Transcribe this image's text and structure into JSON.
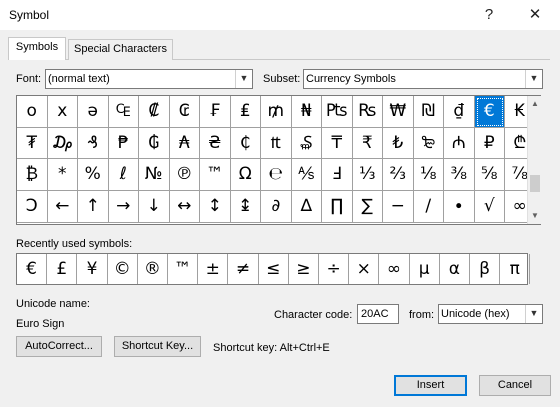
{
  "window": {
    "title": "Symbol",
    "help_label": "?",
    "close_label": "✕"
  },
  "tabs": [
    {
      "label": "Symbols",
      "active": true
    },
    {
      "label": "Special Characters",
      "active": false
    }
  ],
  "font": {
    "label": "Font:",
    "value": "(normal text)"
  },
  "subset": {
    "label": "Subset:",
    "value": "Currency Symbols"
  },
  "symbol_grid": {
    "rows": [
      [
        "ο",
        "х",
        "ə",
        "₠",
        "₡",
        "₢",
        "₣",
        "₤",
        "₥",
        "₦",
        "₧",
        "₨",
        "₩",
        "₪",
        "₫",
        "€",
        "₭"
      ],
      [
        "₮",
        "₯",
        "₰",
        "₱",
        "₲",
        "₳",
        "₴",
        "₵",
        "₶",
        "₷",
        "₸",
        "₹",
        "₺",
        "₻",
        "₼",
        "₽",
        "₾"
      ],
      [
        "₿",
        "*",
        "%",
        "ℓ",
        "№",
        "℗",
        "™",
        "Ω",
        "℮",
        "⅍",
        "Ⅎ",
        "⅓",
        "⅔",
        "⅛",
        "⅜",
        "⅝",
        "⅞"
      ],
      [
        "Ↄ",
        "←",
        "↑",
        "→",
        "↓",
        "↔",
        "↕",
        "↨",
        "∂",
        "∆",
        "∏",
        "∑",
        "−",
        "∕",
        "∙",
        "√",
        "∞"
      ]
    ],
    "selected": "€"
  },
  "recent": {
    "label": "Recently used symbols:",
    "symbols": [
      "€",
      "£",
      "¥",
      "©",
      "®",
      "™",
      "±",
      "≠",
      "≤",
      "≥",
      "÷",
      "×",
      "∞",
      "µ",
      "α",
      "β",
      "π"
    ]
  },
  "unicode": {
    "label": "Unicode name:",
    "value": "Euro Sign"
  },
  "char_code": {
    "label": "Character code:",
    "value": "20AC"
  },
  "from": {
    "label": "from:",
    "value": "Unicode (hex)"
  },
  "buttons": {
    "autocorrect": "AutoCorrect...",
    "shortcut_key": "Shortcut Key...",
    "insert": "Insert",
    "cancel": "Cancel"
  },
  "shortcut_text": "Shortcut key: Alt+Ctrl+E",
  "colors": {
    "selected_bg": "#0078d7",
    "selected_fg": "#ffffff"
  }
}
